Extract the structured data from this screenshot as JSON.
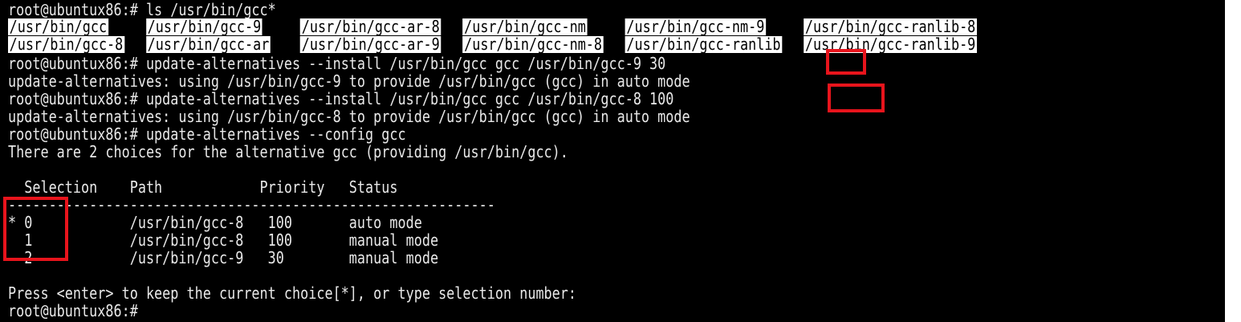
{
  "terminal": {
    "lines": [
      "root@ubuntux86:# ls /usr/bin/gcc*",
      "",
      "",
      "root@ubuntux86:# update-alternatives --install /usr/bin/gcc gcc /usr/bin/gcc-9 30",
      "update-alternatives: using /usr/bin/gcc-9 to provide /usr/bin/gcc (gcc) in auto mode",
      "root@ubuntux86:# update-alternatives --install /usr/bin/gcc gcc /usr/bin/gcc-8 100",
      "update-alternatives: using /usr/bin/gcc-8 to provide /usr/bin/gcc (gcc) in auto mode",
      "root@ubuntux86:# update-alternatives --config gcc",
      "There are 2 choices for the alternative gcc (providing /usr/bin/gcc).",
      "",
      "  Selection    Path            Priority   Status",
      "------------------------------------------------------------",
      "* 0            /usr/bin/gcc-8   100       auto mode",
      "  1            /usr/bin/gcc-8   100       manual mode",
      "  2            /usr/bin/gcc-9   30        manual mode",
      "",
      "Press <enter> to keep the current choice[*], or type selection number:",
      "root@ubuntux86:#"
    ],
    "ls_output": {
      "row1": [
        "/usr/bin/gcc",
        "/usr/bin/gcc-9",
        "/usr/bin/gcc-ar-8",
        "/usr/bin/gcc-nm",
        "/usr/bin/gcc-nm-9",
        "/usr/bin/gcc-ranlib-8"
      ],
      "row2": [
        "/usr/bin/gcc-8",
        "/usr/bin/gcc-ar",
        "/usr/bin/gcc-ar-9",
        "/usr/bin/gcc-nm-8",
        "/usr/bin/gcc-ranlib",
        "/usr/bin/gcc-ranlib-9"
      ]
    },
    "colors": {
      "background": "#000000",
      "foreground": "#e8e8e8",
      "ls_highlight_bg": "#ffffff",
      "annotation": "#e8141c"
    }
  }
}
